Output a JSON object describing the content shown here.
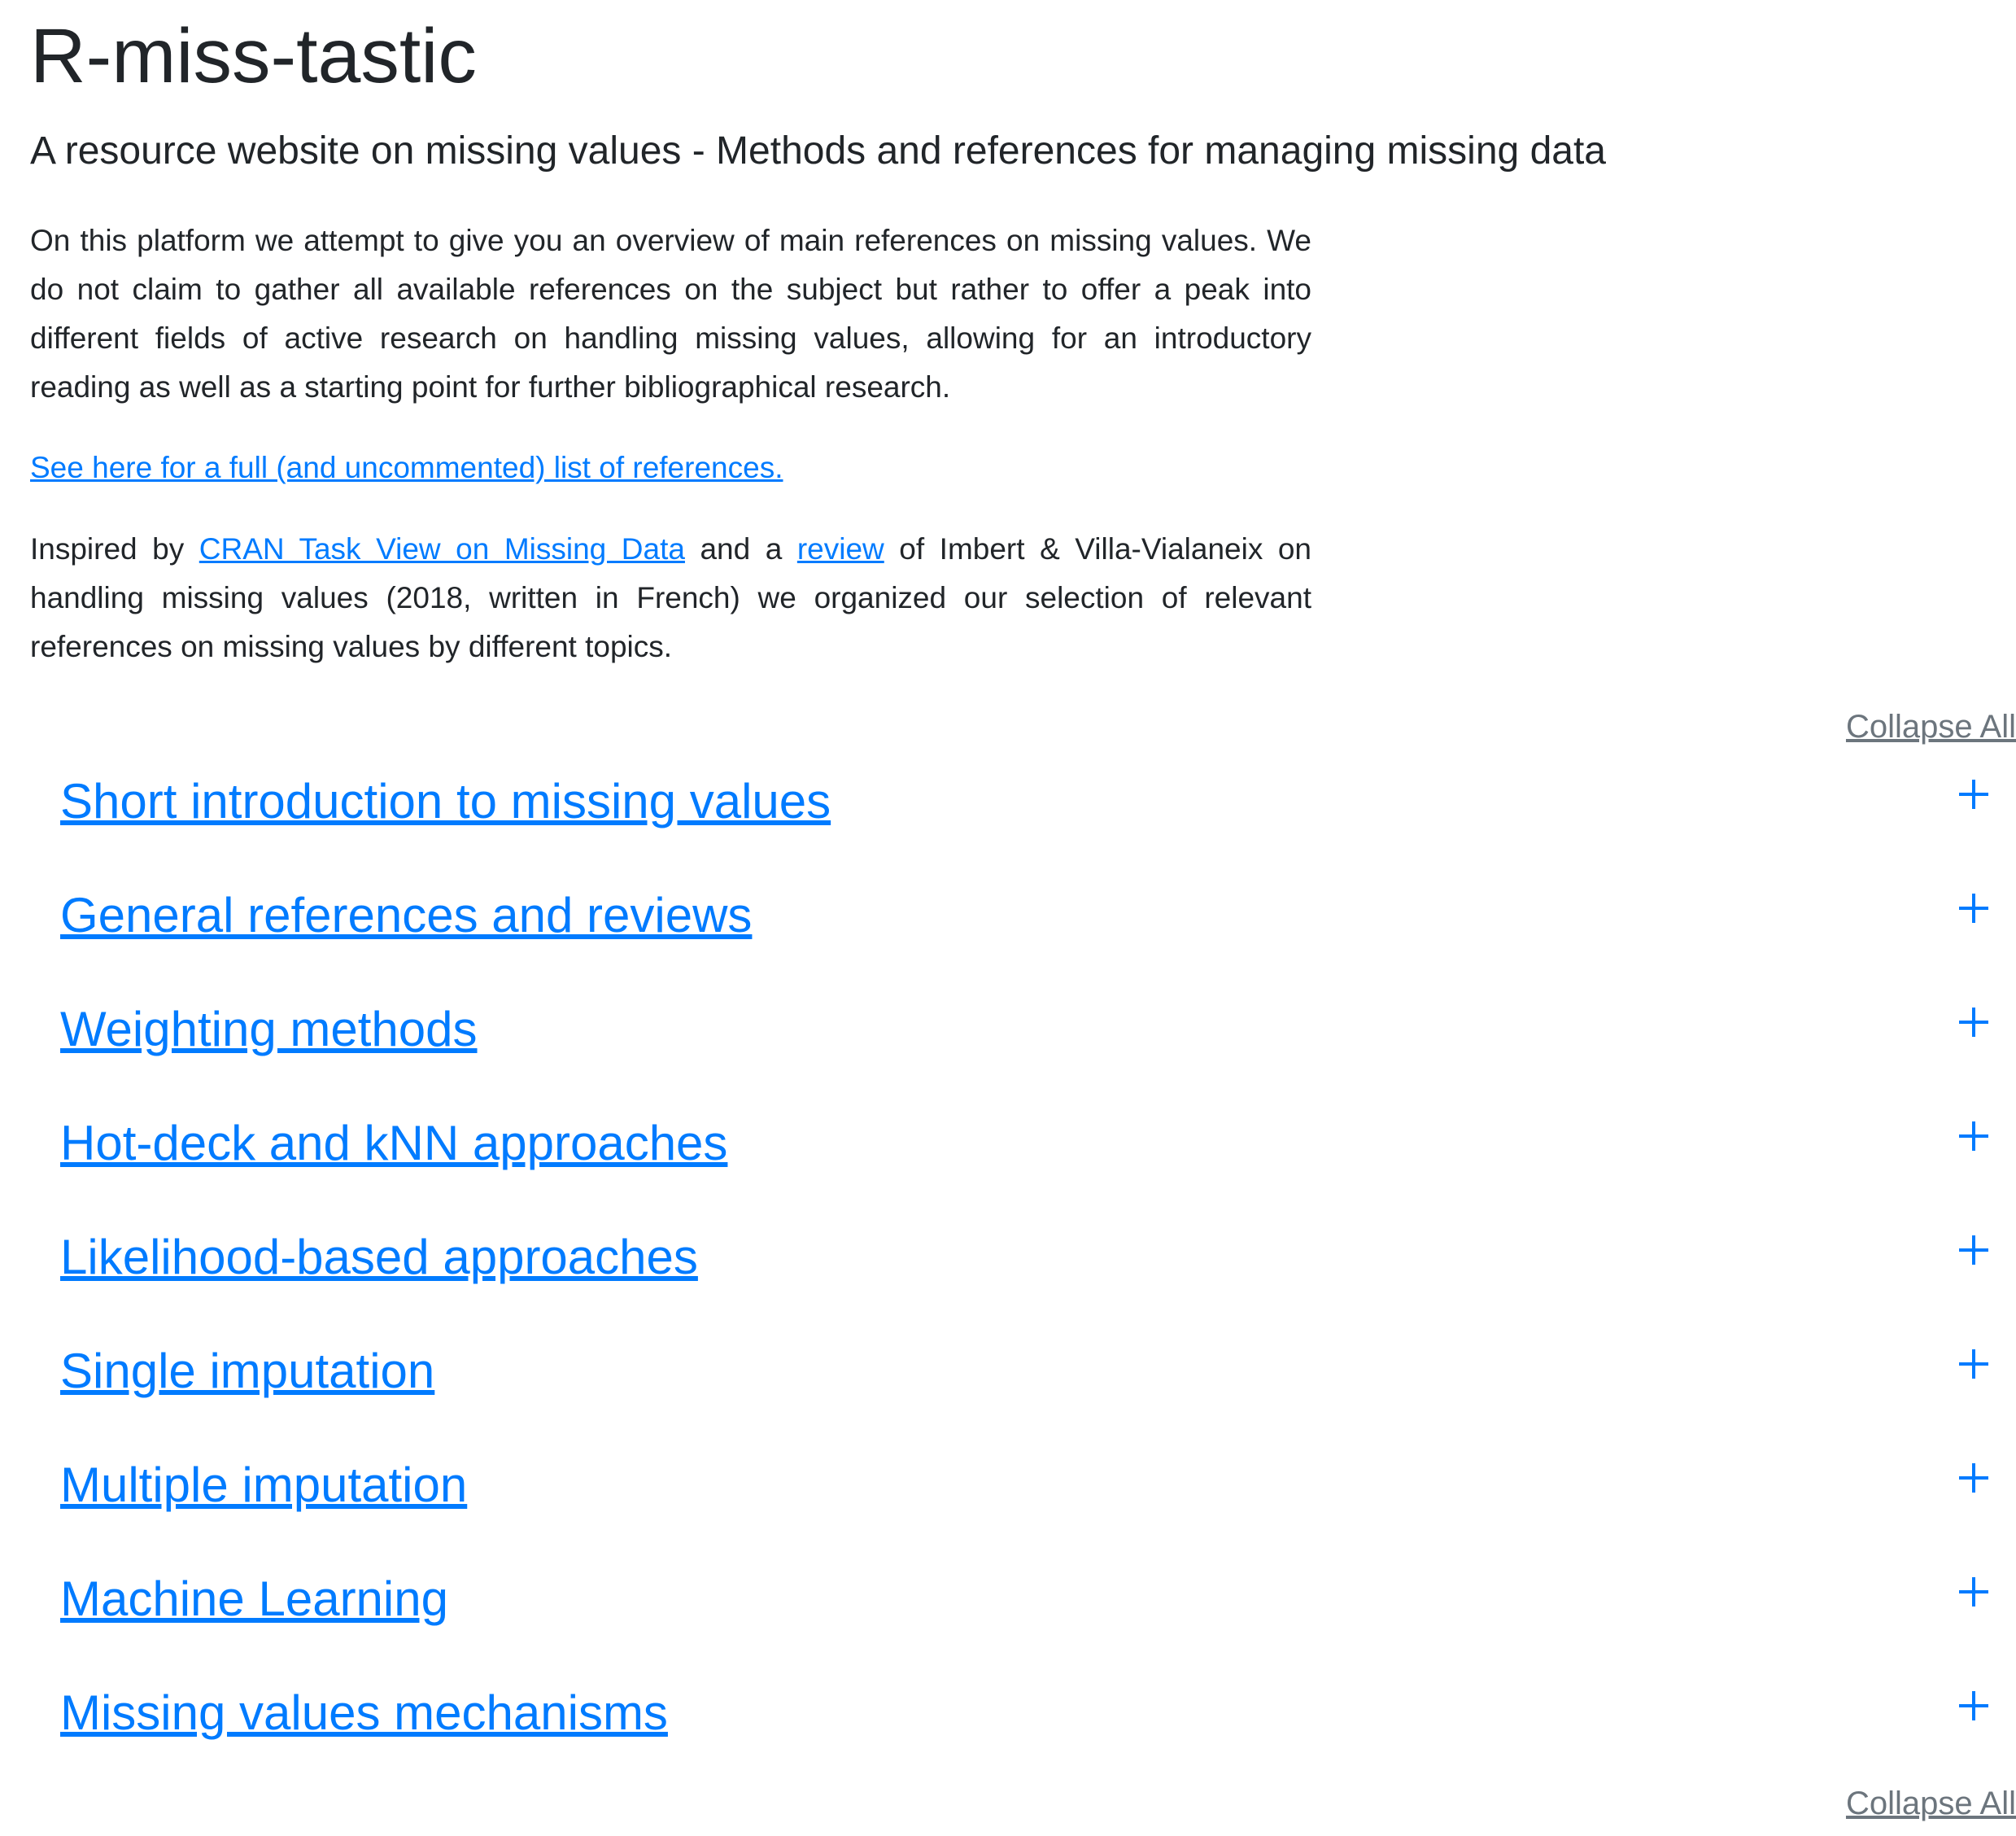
{
  "header": {
    "title": "R-miss-tastic",
    "subtitle": "A resource website on missing values - Methods and references for managing missing data"
  },
  "intro": {
    "paragraph": "On this platform we attempt to give you an overview of main references on missing values. We do not claim to gather all available references on the subject but rather to offer a peak into different fields of active research on handling missing values, allowing for an introductory reading as well as a starting point for further bibliographical research.",
    "full_list_link": "See here for a full (and uncommented) list of references.",
    "inspired_prefix": "Inspired by ",
    "cran_link": "CRAN Task View on Missing Data",
    "inspired_middle": " and a ",
    "review_link": "review",
    "inspired_suffix": " of Imbert & Villa-Vialaneix on handling missing values (2018, written in French) we organized our selection of relevant references on missing values by different topics."
  },
  "controls": {
    "collapse_all_label": "Collapse All"
  },
  "topics": [
    {
      "label": "Short introduction to missing values",
      "expanded": false
    },
    {
      "label": "General references and reviews",
      "expanded": false
    },
    {
      "label": "Weighting methods",
      "expanded": false
    },
    {
      "label": "Hot-deck and kNN approaches",
      "expanded": false
    },
    {
      "label": "Likelihood-based approaches",
      "expanded": false
    },
    {
      "label": "Single imputation",
      "expanded": false
    },
    {
      "label": "Multiple imputation",
      "expanded": false
    },
    {
      "label": "Machine Learning",
      "expanded": false
    },
    {
      "label": "Missing values mechanisms",
      "expanded": false
    }
  ],
  "colors": {
    "link": "#007bff",
    "text": "#212529",
    "muted": "#6c757d",
    "background": "#ffffff"
  },
  "icons": {
    "expand": "plus-icon"
  }
}
